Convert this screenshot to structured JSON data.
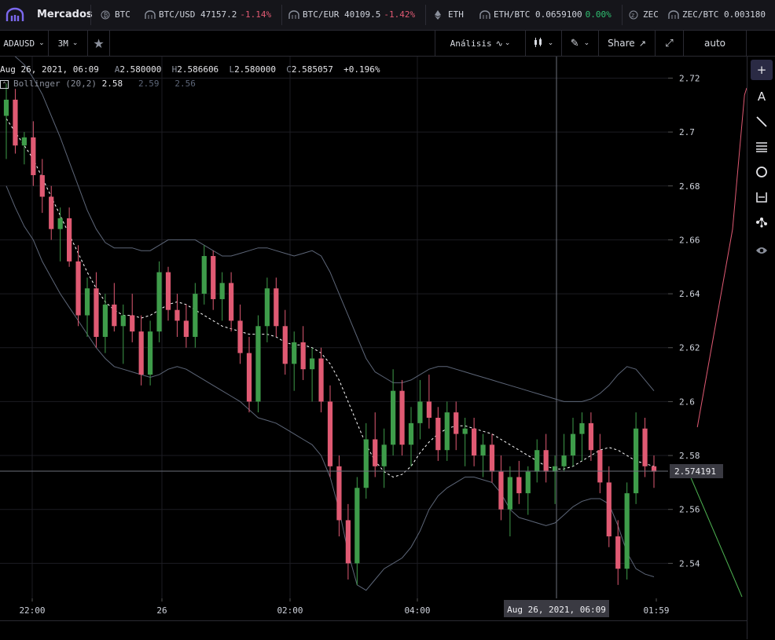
{
  "topbar": {
    "mercados_label": "Mercados",
    "tickers": [
      {
        "icon": "bitcoin-icon",
        "text": "BTC",
        "change": "",
        "dir": ""
      },
      {
        "icon": "exchange-icon",
        "text": "BTC/USD 47157.2",
        "change": "-1.14%",
        "dir": "neg"
      },
      {
        "icon": "exchange-icon",
        "text": "BTC/EUR 40109.5",
        "change": "-1.42%",
        "dir": "neg"
      },
      {
        "icon": "ethereum-icon",
        "text": "ETH",
        "change": "",
        "dir": ""
      },
      {
        "icon": "exchange-icon",
        "text": "ETH/BTC 0.0659100",
        "change": "0.00%",
        "dir": "pos"
      },
      {
        "icon": "zcash-icon",
        "text": "ZEC",
        "change": "",
        "dir": ""
      },
      {
        "icon": "exchange-icon",
        "text": "ZEC/BTC 0.003180",
        "change": "",
        "dir": ""
      }
    ]
  },
  "toolbar": {
    "symbol": "ADAUSD",
    "interval": "3M",
    "analysis": "Análisis",
    "share": "Share",
    "scale_mode": "auto"
  },
  "legend": {
    "date": "Aug 26, 2021, 06:09",
    "open_label": "A",
    "open": "2.580000",
    "high_label": "H",
    "high": "2.586606",
    "low_label": "L",
    "low": "2.580000",
    "close_label": "C",
    "close": "2.585057",
    "change": "+0.196%",
    "indicator": "Bollinger (20,2)",
    "ind_mid": "2.58",
    "ind_upper": "2.59",
    "ind_lower": "2.56"
  },
  "crosshair": {
    "time_label": "Aug 26, 2021, 06:09",
    "price_label": "2.574191",
    "price": 2.574191
  },
  "chart_data": {
    "type": "candlestick",
    "yrange": [
      2.527,
      2.728
    ],
    "price_ticks": [
      "2.72",
      "2.7",
      "2.68",
      "2.66",
      "2.64",
      "2.62",
      "2.6",
      "2.58",
      "2.56",
      "2.54"
    ],
    "time_ticks": [
      "22:00",
      "26",
      "02:00",
      "04:00",
      "01:59"
    ],
    "candles": [
      [
        2.706,
        2.718,
        2.69,
        2.712
      ],
      [
        2.712,
        2.716,
        2.692,
        2.695
      ],
      [
        2.695,
        2.7,
        2.688,
        2.698
      ],
      [
        2.698,
        2.704,
        2.68,
        2.684
      ],
      [
        2.684,
        2.69,
        2.67,
        2.676
      ],
      [
        2.676,
        2.68,
        2.66,
        2.664
      ],
      [
        2.664,
        2.672,
        2.652,
        2.668
      ],
      [
        2.668,
        2.672,
        2.65,
        2.652
      ],
      [
        2.652,
        2.658,
        2.628,
        2.632
      ],
      [
        2.632,
        2.646,
        2.624,
        2.642
      ],
      [
        2.642,
        2.648,
        2.62,
        2.624
      ],
      [
        2.624,
        2.64,
        2.618,
        2.636
      ],
      [
        2.636,
        2.644,
        2.626,
        2.628
      ],
      [
        2.628,
        2.636,
        2.614,
        2.632
      ],
      [
        2.632,
        2.64,
        2.622,
        2.626
      ],
      [
        2.626,
        2.632,
        2.606,
        2.61
      ],
      [
        2.61,
        2.63,
        2.606,
        2.626
      ],
      [
        2.626,
        2.652,
        2.622,
        2.648
      ],
      [
        2.648,
        2.65,
        2.63,
        2.634
      ],
      [
        2.634,
        2.64,
        2.624,
        2.63
      ],
      [
        2.63,
        2.636,
        2.62,
        2.624
      ],
      [
        2.624,
        2.644,
        2.62,
        2.64
      ],
      [
        2.64,
        2.658,
        2.636,
        2.654
      ],
      [
        2.654,
        2.656,
        2.634,
        2.638
      ],
      [
        2.638,
        2.648,
        2.63,
        2.644
      ],
      [
        2.644,
        2.648,
        2.626,
        2.63
      ],
      [
        2.63,
        2.636,
        2.614,
        2.618
      ],
      [
        2.618,
        2.624,
        2.596,
        2.6
      ],
      [
        2.6,
        2.632,
        2.596,
        2.628
      ],
      [
        2.628,
        2.646,
        2.622,
        2.642
      ],
      [
        2.642,
        2.646,
        2.624,
        2.628
      ],
      [
        2.628,
        2.634,
        2.61,
        2.614
      ],
      [
        2.614,
        2.626,
        2.604,
        2.622
      ],
      [
        2.622,
        2.628,
        2.608,
        2.612
      ],
      [
        2.612,
        2.62,
        2.6,
        2.616
      ],
      [
        2.616,
        2.62,
        2.596,
        2.6
      ],
      [
        2.6,
        2.606,
        2.572,
        2.576
      ],
      [
        2.576,
        2.58,
        2.55,
        2.556
      ],
      [
        2.556,
        2.562,
        2.534,
        2.54
      ],
      [
        2.54,
        2.572,
        2.532,
        2.568
      ],
      [
        2.568,
        2.592,
        2.564,
        2.586
      ],
      [
        2.586,
        2.596,
        2.572,
        2.576
      ],
      [
        2.576,
        2.59,
        2.568,
        2.584
      ],
      [
        2.584,
        2.612,
        2.58,
        2.604
      ],
      [
        2.604,
        2.608,
        2.58,
        2.584
      ],
      [
        2.584,
        2.598,
        2.576,
        2.592
      ],
      [
        2.592,
        2.608,
        2.586,
        2.6
      ],
      [
        2.6,
        2.61,
        2.59,
        2.594
      ],
      [
        2.594,
        2.598,
        2.578,
        2.582
      ],
      [
        2.582,
        2.6,
        2.578,
        2.596
      ],
      [
        2.596,
        2.6,
        2.582,
        2.588
      ],
      [
        2.588,
        2.594,
        2.576,
        2.59
      ],
      [
        2.59,
        2.594,
        2.576,
        2.58
      ],
      [
        2.58,
        2.588,
        2.572,
        2.584
      ],
      [
        2.584,
        2.588,
        2.57,
        2.574
      ],
      [
        2.574,
        2.58,
        2.556,
        2.56
      ],
      [
        2.56,
        2.576,
        2.55,
        2.572
      ],
      [
        2.572,
        2.578,
        2.562,
        2.566
      ],
      [
        2.566,
        2.576,
        2.558,
        2.574
      ],
      [
        2.574,
        2.586,
        2.57,
        2.582
      ],
      [
        2.582,
        2.588,
        2.57,
        2.574
      ],
      [
        2.574,
        2.58,
        2.562,
        2.576
      ],
      [
        2.576,
        2.588,
        2.574,
        2.58
      ],
      [
        2.58,
        2.594,
        2.576,
        2.588
      ],
      [
        2.588,
        2.596,
        2.578,
        2.592
      ],
      [
        2.592,
        2.596,
        2.578,
        2.582
      ],
      [
        2.582,
        2.588,
        2.566,
        2.57
      ],
      [
        2.57,
        2.576,
        2.546,
        2.55
      ],
      [
        2.55,
        2.556,
        2.532,
        2.538
      ],
      [
        2.538,
        2.57,
        2.534,
        2.566
      ],
      [
        2.566,
        2.596,
        2.562,
        2.59
      ],
      [
        2.59,
        2.594,
        2.572,
        2.576
      ],
      [
        2.576,
        2.58,
        2.568,
        2.574
      ]
    ],
    "bollinger_mid": [
      2.705,
      2.7,
      2.695,
      2.69,
      2.683,
      2.676,
      2.669,
      2.662,
      2.655,
      2.648,
      2.642,
      2.637,
      2.634,
      2.632,
      2.632,
      2.631,
      2.632,
      2.634,
      2.636,
      2.637,
      2.636,
      2.634,
      2.632,
      2.63,
      2.628,
      2.627,
      2.626,
      2.625,
      2.625,
      2.625,
      2.624,
      2.622,
      2.621,
      2.621,
      2.62,
      2.618,
      2.614,
      2.608,
      2.6,
      2.592,
      2.584,
      2.578,
      2.574,
      2.572,
      2.573,
      2.576,
      2.581,
      2.585,
      2.588,
      2.59,
      2.591,
      2.591,
      2.59,
      2.589,
      2.588,
      2.586,
      2.584,
      2.582,
      2.58,
      2.578,
      2.576,
      2.575,
      2.575,
      2.576,
      2.578,
      2.58,
      2.582,
      2.583,
      2.582,
      2.58,
      2.578,
      2.577,
      2.576
    ],
    "bollinger_upper": [
      2.73,
      2.728,
      2.725,
      2.72,
      2.714,
      2.706,
      2.698,
      2.689,
      2.68,
      2.671,
      2.664,
      2.659,
      2.657,
      2.657,
      2.657,
      2.656,
      2.656,
      2.658,
      2.66,
      2.66,
      2.66,
      2.66,
      2.658,
      2.656,
      2.654,
      2.654,
      2.655,
      2.656,
      2.657,
      2.657,
      2.656,
      2.655,
      2.654,
      2.655,
      2.656,
      2.654,
      2.648,
      2.64,
      2.632,
      2.624,
      2.616,
      2.611,
      2.609,
      2.607,
      2.607,
      2.608,
      2.61,
      2.612,
      2.613,
      2.613,
      2.612,
      2.611,
      2.61,
      2.609,
      2.608,
      2.607,
      2.606,
      2.605,
      2.604,
      2.603,
      2.602,
      2.601,
      2.6,
      2.6,
      2.6,
      2.601,
      2.603,
      2.606,
      2.61,
      2.613,
      2.612,
      2.608,
      2.604
    ],
    "bollinger_lower": [
      2.68,
      2.672,
      2.665,
      2.66,
      2.652,
      2.646,
      2.64,
      2.635,
      2.63,
      2.625,
      2.62,
      2.616,
      2.613,
      2.612,
      2.611,
      2.61,
      2.609,
      2.61,
      2.612,
      2.613,
      2.612,
      2.61,
      2.608,
      2.606,
      2.604,
      2.602,
      2.6,
      2.597,
      2.594,
      2.593,
      2.592,
      2.59,
      2.588,
      2.586,
      2.584,
      2.58,
      2.572,
      2.56,
      2.544,
      2.532,
      2.53,
      2.534,
      2.538,
      2.54,
      2.542,
      2.546,
      2.552,
      2.56,
      2.565,
      2.568,
      2.57,
      2.572,
      2.572,
      2.571,
      2.57,
      2.566,
      2.56,
      2.557,
      2.556,
      2.555,
      2.554,
      2.555,
      2.558,
      2.561,
      2.563,
      2.564,
      2.564,
      2.562,
      2.554,
      2.544,
      2.538,
      2.536,
      2.535
    ]
  },
  "colors": {
    "up": "#3e9c4a",
    "down": "#e05a73",
    "band": "#5d6678",
    "mid": "#ffffff",
    "grid": "#1f1f24",
    "text": "#cfd3dc",
    "accent": "#7b68ee",
    "depth_bid": "#e05a73",
    "depth_ask": "#4caf50"
  },
  "right_tools": [
    "crosshair-tool-icon",
    "text-tool-icon",
    "line-tool-icon",
    "fib-tool-icon",
    "circle-tool-icon",
    "measure-tool-icon",
    "pattern-tool-icon",
    "visibility-toggle-icon"
  ]
}
